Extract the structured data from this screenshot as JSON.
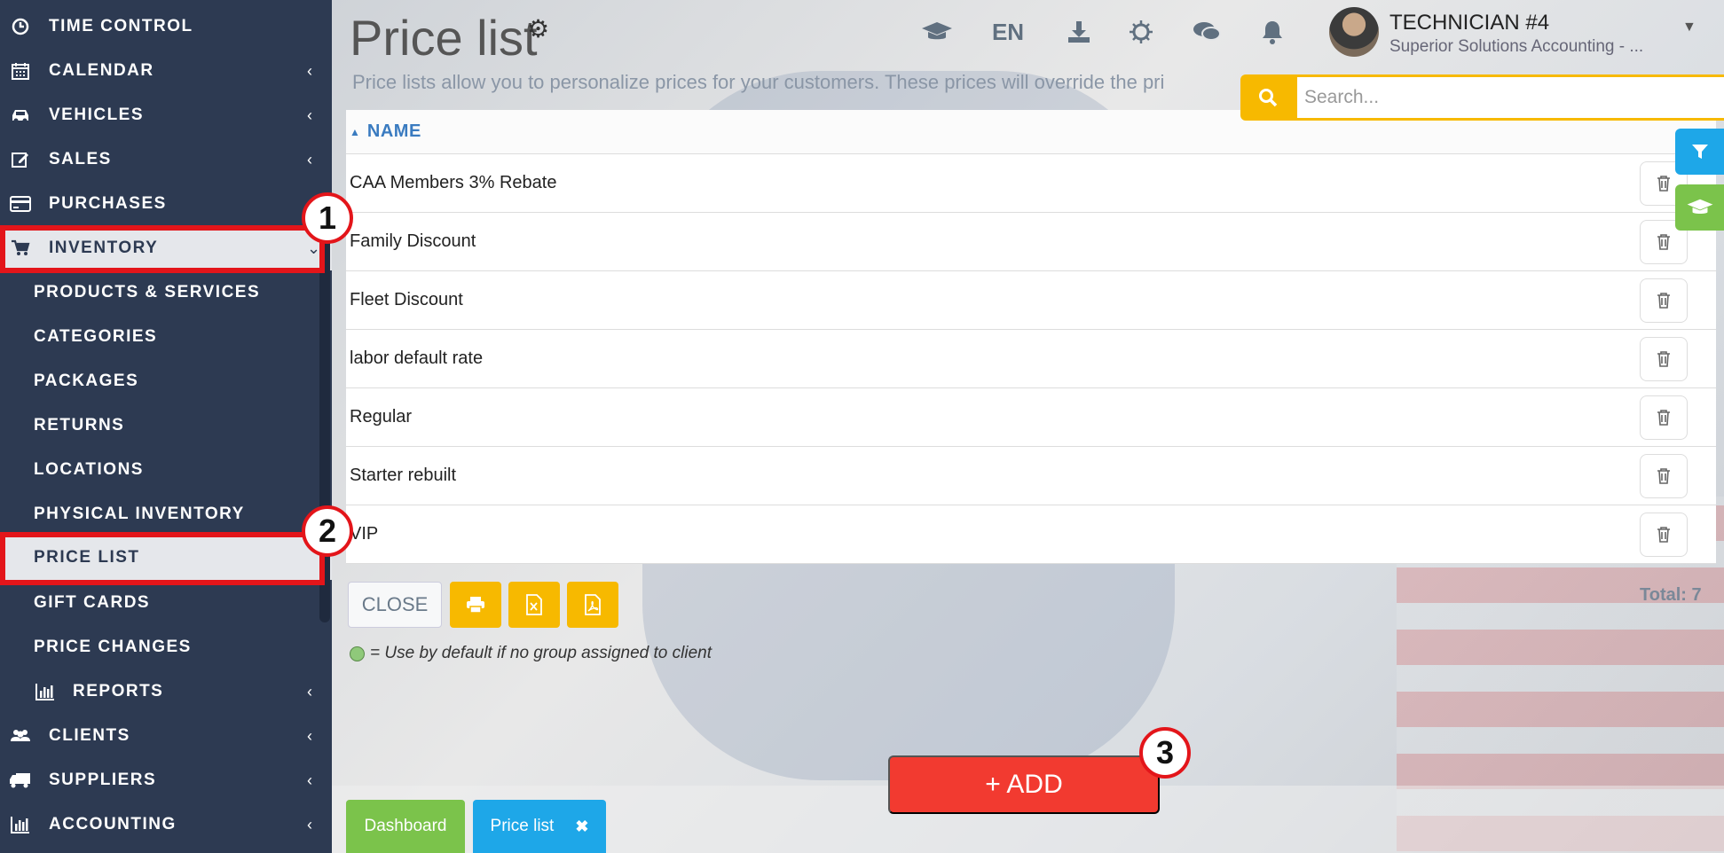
{
  "sidebar": {
    "items": [
      {
        "label": "TIME CONTROL",
        "icon": "clock-icon",
        "chevron": ""
      },
      {
        "label": "CALENDAR",
        "icon": "calendar-icon",
        "chevron": "‹"
      },
      {
        "label": "VEHICLES",
        "icon": "car-icon",
        "chevron": "‹"
      },
      {
        "label": "SALES",
        "icon": "edit-icon",
        "chevron": "‹"
      },
      {
        "label": "PURCHASES",
        "icon": "credit-card-icon",
        "chevron": ""
      },
      {
        "label": "INVENTORY",
        "icon": "cart-icon",
        "chevron": "⌄"
      }
    ],
    "sub_items": [
      {
        "label": "PRODUCTS & SERVICES"
      },
      {
        "label": "CATEGORIES"
      },
      {
        "label": "PACKAGES"
      },
      {
        "label": "RETURNS"
      },
      {
        "label": "LOCATIONS"
      },
      {
        "label": "PHYSICAL INVENTORY"
      },
      {
        "label": "PRICE LIST"
      },
      {
        "label": "GIFT CARDS"
      },
      {
        "label": "PRICE CHANGES"
      }
    ],
    "reports": {
      "label": "REPORTS",
      "icon": "bar-chart-icon",
      "chevron": "‹"
    },
    "bottom_items": [
      {
        "label": "CLIENTS",
        "icon": "users-icon",
        "chevron": "‹"
      },
      {
        "label": "SUPPLIERS",
        "icon": "truck-icon",
        "chevron": "‹"
      },
      {
        "label": "ACCOUNTING",
        "icon": "bar-chart-icon",
        "chevron": "‹"
      }
    ]
  },
  "header": {
    "title": "Price list",
    "description": "Price lists allow you to personalize prices for your customers. These prices will override the pri",
    "lang": "EN",
    "user_name": "TECHNICIAN #4",
    "user_company": "Superior Solutions Accounting - ..."
  },
  "search": {
    "placeholder": "Search...",
    "value": ""
  },
  "table": {
    "column": "NAME",
    "rows": [
      "CAA Members 3% Rebate",
      "Family Discount",
      "Fleet Discount",
      "labor default rate",
      "Regular",
      "Starter rebuilt",
      "VIP"
    ]
  },
  "controls": {
    "close_label": "CLOSE",
    "total": "Total: 7",
    "legend": "= Use by default if no group assigned to client",
    "add_label": "+ ADD"
  },
  "tabs": {
    "dashboard": "Dashboard",
    "price_list": "Price list"
  },
  "annotations": {
    "one": "1",
    "two": "2",
    "three": "3"
  },
  "colors": {
    "sidebar": "#2d3a52",
    "accent_yellow": "#f7b900",
    "add_red": "#f23a30",
    "highlight_red": "#e3151a",
    "tab_blue": "#1ea7e8",
    "tab_green": "#7bc34b"
  }
}
